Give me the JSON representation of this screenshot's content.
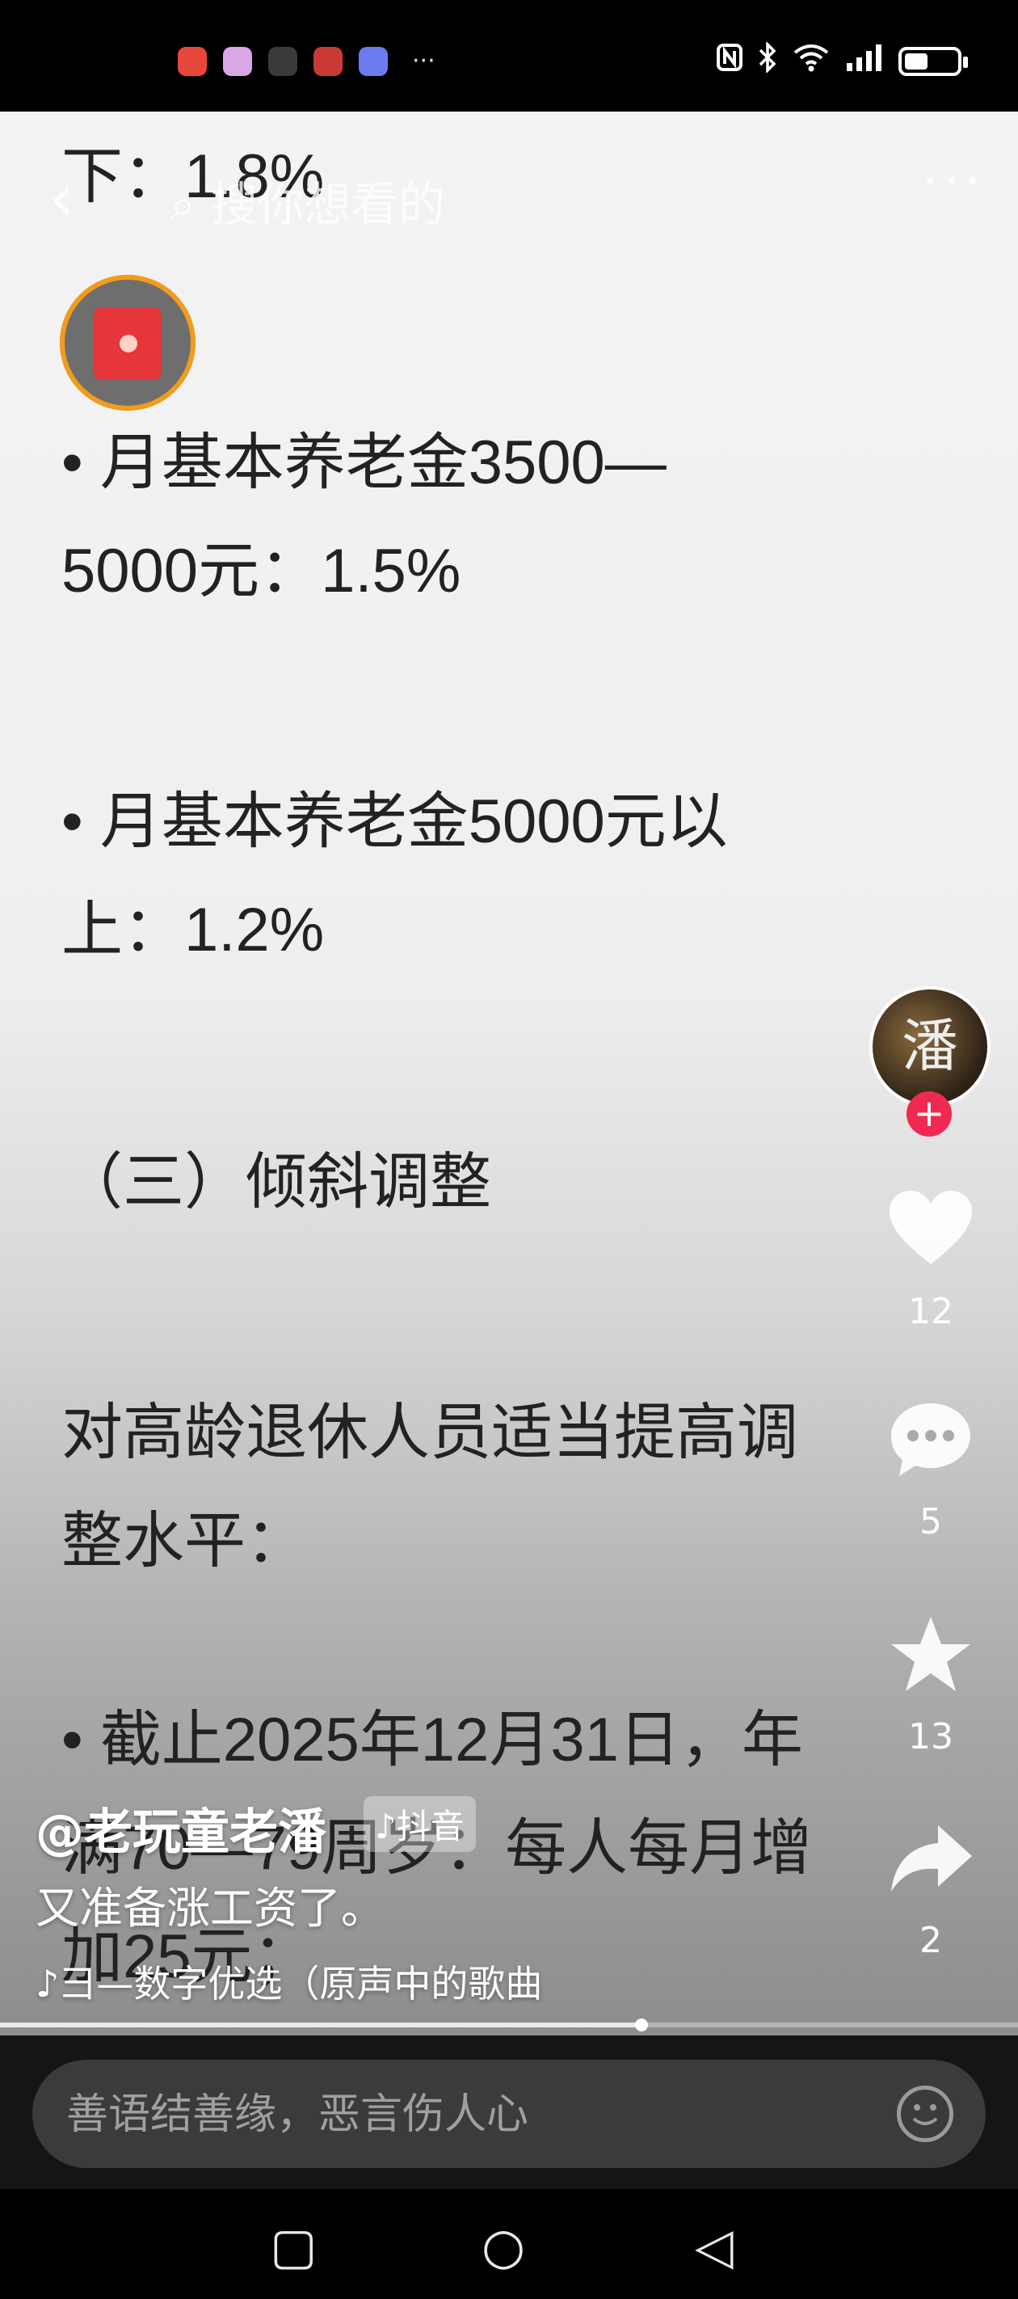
{
  "status_bar": {
    "app_icons": [
      "#e8483b",
      "#d9a6e6",
      "#3a3a3a",
      "#c93a36",
      "#6c7cf0"
    ],
    "more": "···",
    "right_icons": [
      "nfc-icon",
      "bluetooth-icon",
      "wifi-icon",
      "signal-icon",
      "battery-icon"
    ],
    "battery_level": 0.45
  },
  "topbar": {
    "back": "‹",
    "search_hint": "搜你想看的",
    "more": "···"
  },
  "document": {
    "line0": "下：1.8%",
    "line1": "• 月基本养老金3500—",
    "line2": "5000元：1.5%",
    "line3": "• 月基本养老金5000元以",
    "line4": "上：1.2%",
    "line5": "（三）倾斜调整",
    "line6": "对高龄退休人员适当提高调",
    "line7": "整水平：",
    "line8": "• 截止2025年12月31日，年",
    "line9": "满70—79周岁：每人每月增",
    "line10": "加25元；"
  },
  "rail": {
    "avatar_char": "潘",
    "follow": "+",
    "like_count": "12",
    "comment_count": "5",
    "favorite_count": "13",
    "share_count": "2"
  },
  "overlay": {
    "username": "@老玩童老潘",
    "platform_badge": "♪抖音",
    "caption": "又准备涨工资了。",
    "music": "♪彐—数字优选（原声中的歌曲"
  },
  "progress": {
    "value": 0.63
  },
  "comment": {
    "placeholder": "善语结善缘，恶言伤人心"
  },
  "navbar": {
    "recent": "▢",
    "home": "○",
    "back": "◁"
  }
}
